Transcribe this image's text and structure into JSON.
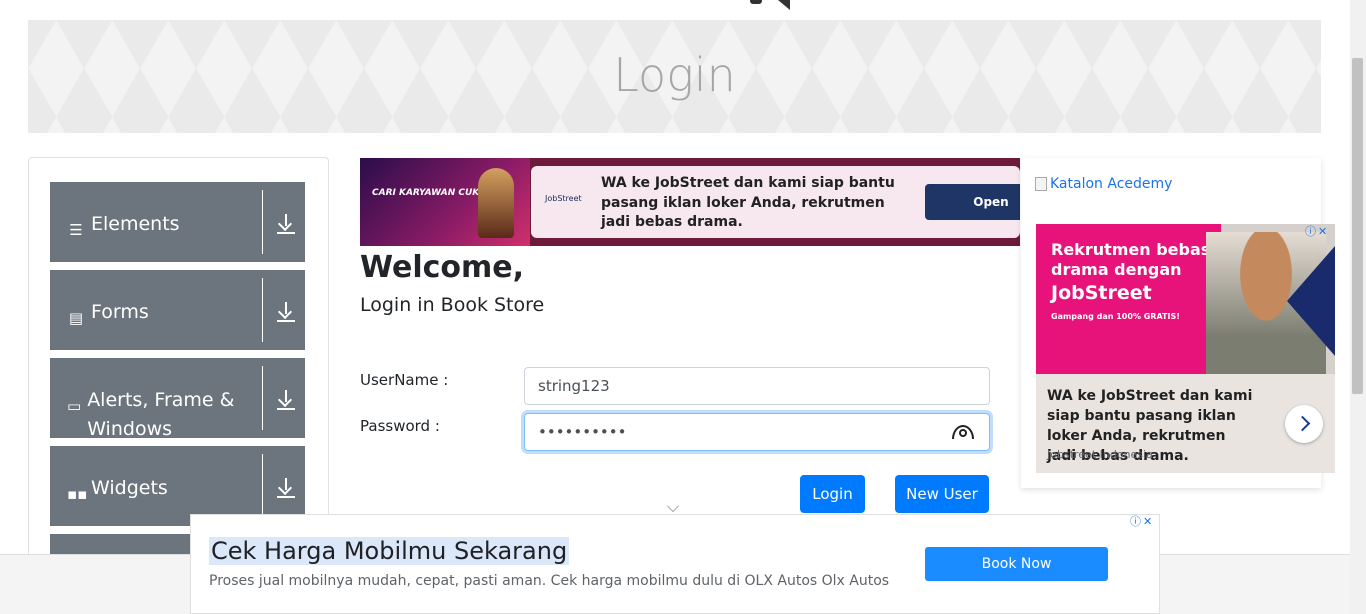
{
  "page": {
    "title": "Login"
  },
  "sidebar": {
    "groups": [
      {
        "label": "Elements",
        "icon": "hamburger-icon"
      },
      {
        "label": "Forms",
        "icon": "document-icon"
      },
      {
        "label": "Alerts, Frame & Windows",
        "icon": "window-icon"
      },
      {
        "label": "Widgets",
        "icon": "widgets-grid-icon"
      }
    ]
  },
  "ads": {
    "top": {
      "promo": "CARI KARYAWAN CUKUP",
      "logo": "JobStreet",
      "text": "WA ke JobStreet dan kami siap bantu pasang iklan loker Anda, rekrutmen jadi bebas drama.",
      "button": "Open"
    },
    "side": {
      "headline": "Rekrutmen bebas drama dengan",
      "logo": "JobStreet",
      "tagline": "Gampang dan 100% GRATIS!",
      "text": "WA ke JobStreet dan kami siap bantu pasang iklan loker Anda, rekrutmen jadi bebas drama.",
      "source": "Jobstreet Indonesia"
    },
    "bottom": {
      "title": "Cek Harga Mobilmu Sekarang",
      "desc": "Proses jual mobilnya mudah, cepat, pasti aman. Cek harga mobilmu dulu di OLX Autos Olx Autos",
      "button": "Book Now"
    }
  },
  "katalon": {
    "alt": "Katalon Acedemy"
  },
  "form": {
    "welcome": "Welcome,",
    "subtitle": "Login in Book Store",
    "username_label": "UserName :",
    "username_value": "string123",
    "password_label": "Password :",
    "password_value": "••••••••••",
    "login_label": "Login",
    "new_user_label": "New User"
  },
  "colors": {
    "primary": "#007bff",
    "sidebar": "#6c757d",
    "brand_pink": "#e8137a",
    "brand_navy": "#1a2b6d"
  }
}
